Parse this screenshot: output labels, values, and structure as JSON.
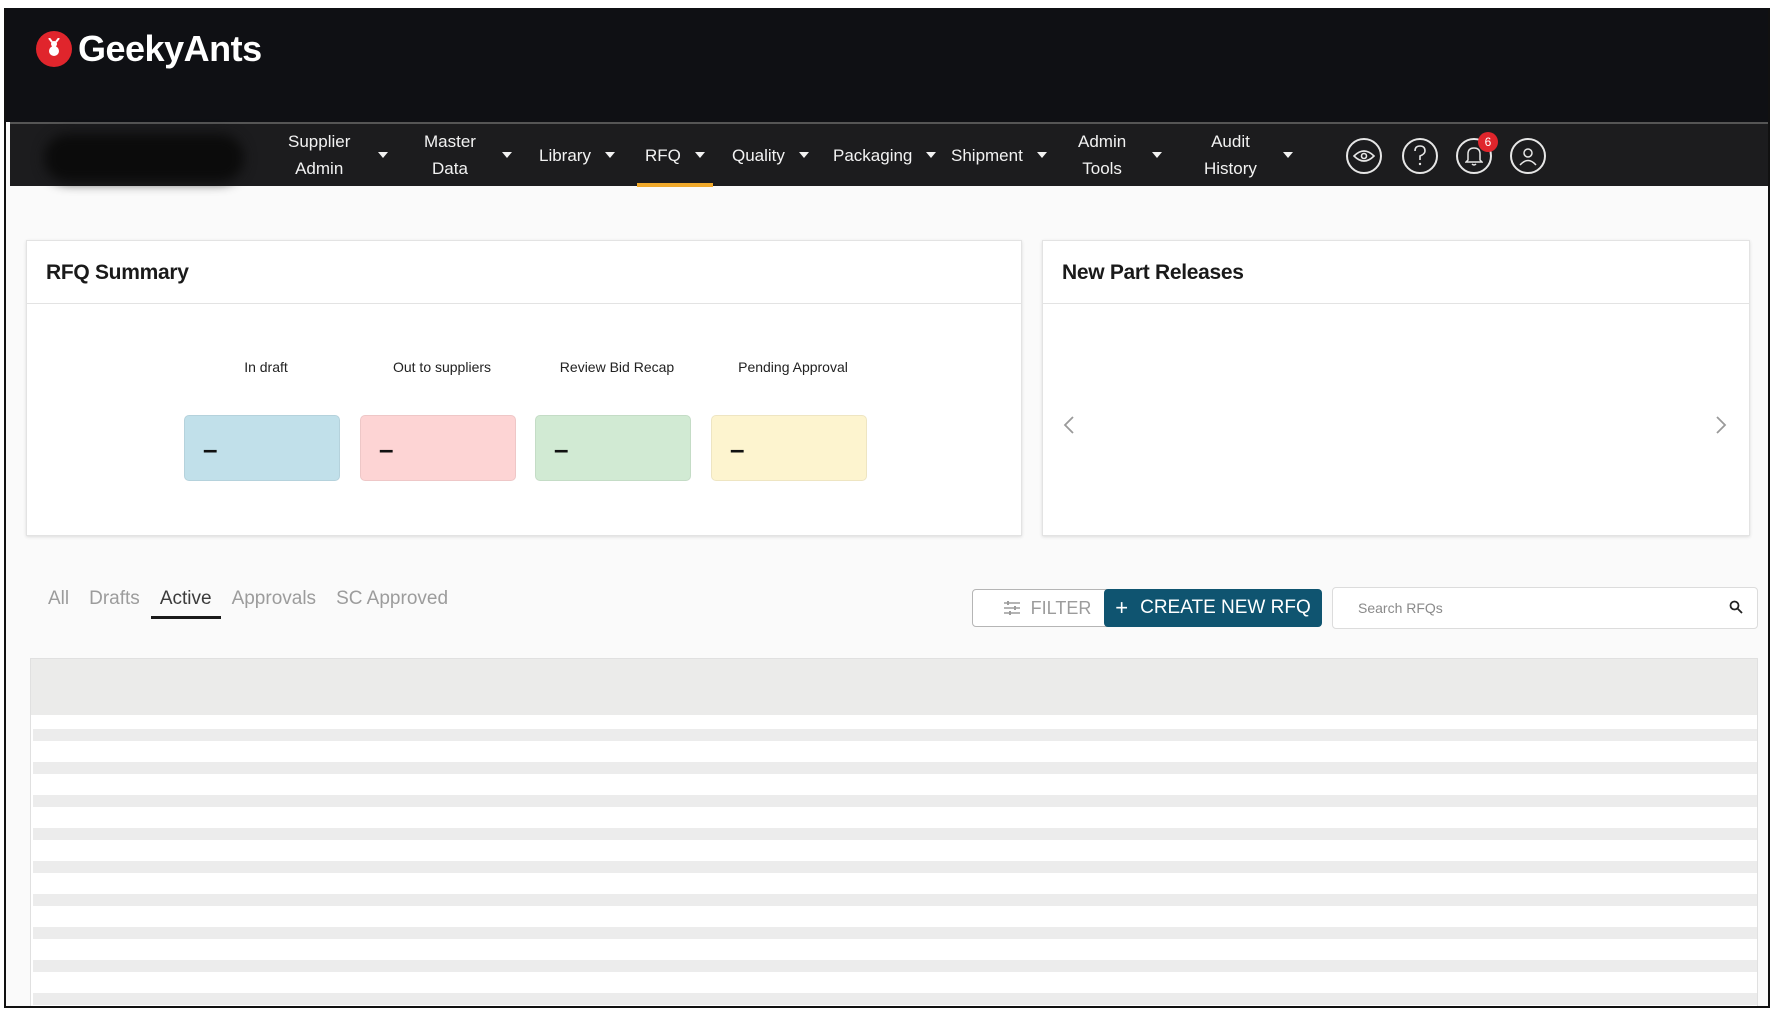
{
  "brand": {
    "name": "GeekyAnts"
  },
  "nav": {
    "items": [
      {
        "label": "Supplier Admin",
        "line1": "Supplier",
        "line2": "Admin"
      },
      {
        "label": "Master Data",
        "line1": "Master",
        "line2": "Data"
      },
      {
        "label": "Library"
      },
      {
        "label": "RFQ",
        "active": true
      },
      {
        "label": "Quality"
      },
      {
        "label": "Packaging"
      },
      {
        "label": "Shipment"
      },
      {
        "label": "Admin Tools",
        "line1": "Admin",
        "line2": "Tools"
      },
      {
        "label": "Audit History",
        "line1": "Audit",
        "line2": "History"
      }
    ],
    "icons": [
      "eye-icon",
      "help-icon",
      "bell-icon",
      "user-icon"
    ],
    "notification_count": "6",
    "active_color": "#f0a92b"
  },
  "rfq_summary": {
    "title": "RFQ Summary",
    "stats": [
      {
        "label": "In draft",
        "value": "–",
        "color": "#c1e0ea"
      },
      {
        "label": "Out to suppliers",
        "value": "–",
        "color": "#fdd4d4"
      },
      {
        "label": "Review Bid Recap",
        "value": "–",
        "color": "#d1ead3"
      },
      {
        "label": "Pending Approval",
        "value": "–",
        "color": "#fdf4cf"
      }
    ]
  },
  "new_part_releases": {
    "title": "New Part Releases"
  },
  "tabs": [
    "All",
    "Drafts",
    "Active",
    "Approvals",
    "SC Approved"
  ],
  "active_tab": "Active",
  "toolbar": {
    "filter_label": "FILTER",
    "create_label": "CREATE NEW RFQ",
    "create_color": "#0f5470",
    "search_placeholder": "Search RFQs"
  }
}
